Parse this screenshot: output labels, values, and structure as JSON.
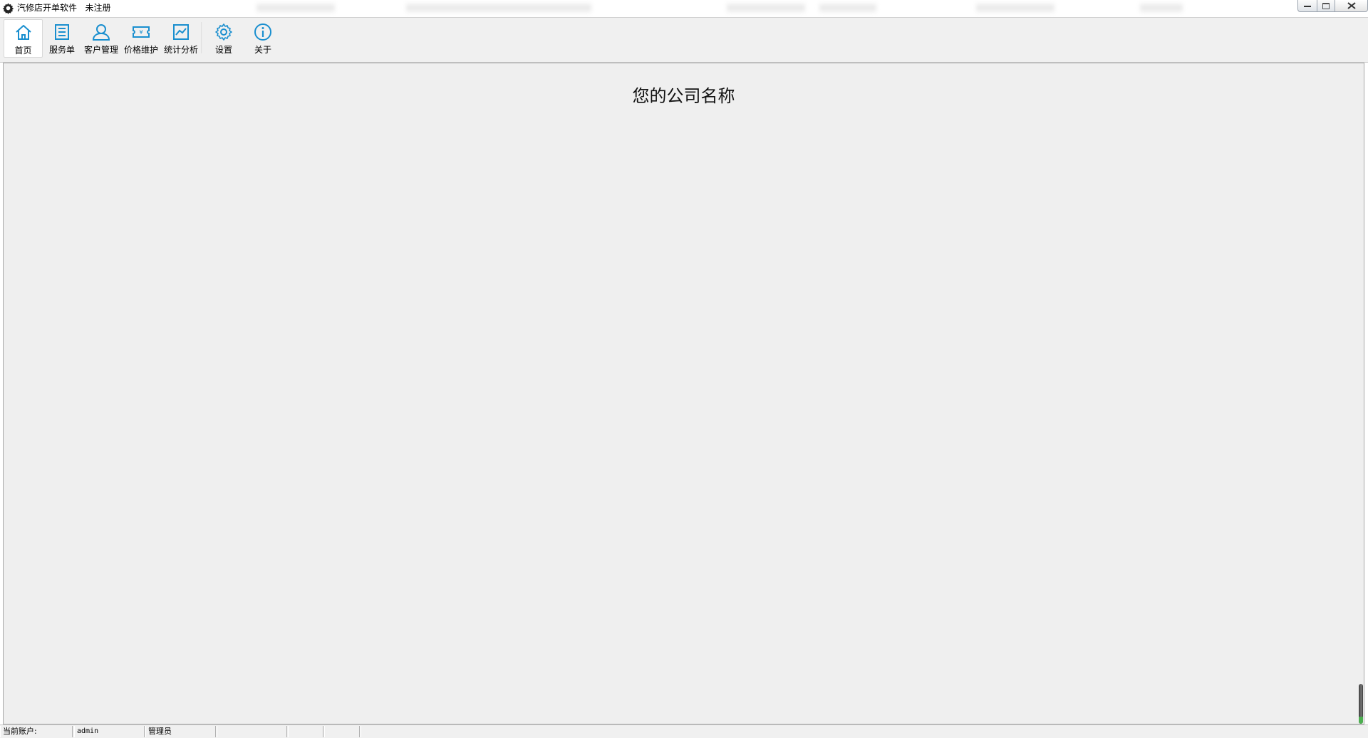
{
  "window": {
    "title": "汽修店开单软件",
    "registration_status": "未注册",
    "controls": [
      "minimize",
      "maximize",
      "close"
    ]
  },
  "toolbar": {
    "items": [
      {
        "label": "首页",
        "icon": "home-icon",
        "active": true
      },
      {
        "label": "服务单",
        "icon": "list-icon"
      },
      {
        "label": "客户管理",
        "icon": "user-icon"
      },
      {
        "label": "价格维护",
        "icon": "price-ticket-icon"
      },
      {
        "label": "统计分析",
        "icon": "chart-icon"
      },
      {
        "label": "设置",
        "icon": "gear-icon"
      },
      {
        "label": "关于",
        "icon": "info-icon"
      }
    ]
  },
  "main": {
    "company_name": "您的公司名称"
  },
  "statusbar": {
    "account_label": "当前账户:",
    "account_value": "admin",
    "role": "管理员"
  },
  "colors": {
    "icon_accent": "#1a8fcf",
    "content_bg": "#efefef",
    "toolbar_bg": "#f0f0f0"
  }
}
